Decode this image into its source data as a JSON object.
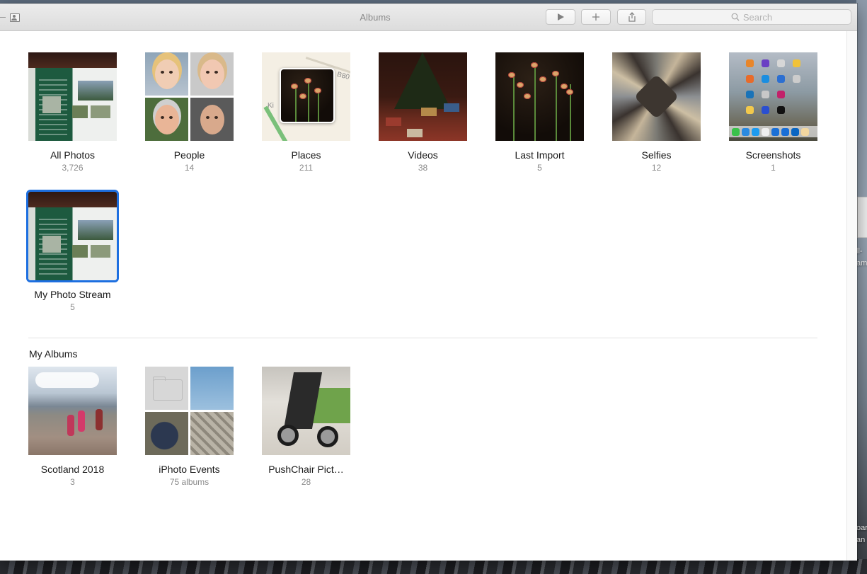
{
  "window": {
    "title": "Albums"
  },
  "toolbar": {
    "play_icon": "play-icon",
    "add_icon": "plus-icon",
    "share_icon": "share-icon",
    "search_placeholder": "Search"
  },
  "albums": [
    {
      "name": "All Photos",
      "count": "3,726"
    },
    {
      "name": "People",
      "count": "14"
    },
    {
      "name": "Places",
      "count": "211"
    },
    {
      "name": "Videos",
      "count": "38"
    },
    {
      "name": "Last Import",
      "count": "5"
    },
    {
      "name": "Selfies",
      "count": "12"
    },
    {
      "name": "Screenshots",
      "count": "1"
    },
    {
      "name": "My Photo Stream",
      "count": "5",
      "selected": true
    }
  ],
  "places_map_labels": [
    "Ki",
    "B80"
  ],
  "my_albums": {
    "title": "My Albums",
    "items": [
      {
        "name": "Scotland 2018",
        "count": "3"
      },
      {
        "name": "iPhoto Events",
        "count": "75 albums"
      },
      {
        "name": "PushChair Pict…",
        "count": "28"
      }
    ]
  },
  "desktop_fragments": [
    "ll-",
    "am",
    "oar",
    "an"
  ],
  "colors": {
    "selection": "#1d6fe0",
    "text": "#1a1a1a",
    "secondary_text": "#8a8a8a"
  }
}
